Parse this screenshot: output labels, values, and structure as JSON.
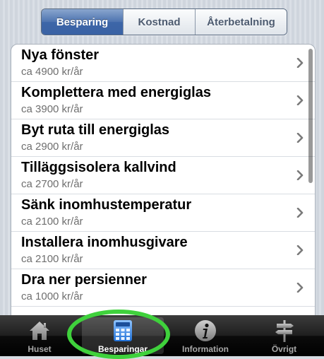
{
  "segments": [
    {
      "label": "Besparing",
      "selected": true
    },
    {
      "label": "Kostnad",
      "selected": false
    },
    {
      "label": "Återbetalning",
      "selected": false
    }
  ],
  "rows": [
    {
      "title": "Nya fönster",
      "subtitle": "ca 4900 kr/år"
    },
    {
      "title": "Komplettera med energiglas",
      "subtitle": "ca 3900 kr/år"
    },
    {
      "title": "Byt ruta till energiglas",
      "subtitle": "ca 2900 kr/år"
    },
    {
      "title": "Tilläggsisolera kallvind",
      "subtitle": "ca 2700 kr/år"
    },
    {
      "title": "Sänk inomhustemperatur",
      "subtitle": "ca 2100 kr/år"
    },
    {
      "title": "Installera inomhusgivare",
      "subtitle": "ca 2100 kr/år"
    },
    {
      "title": "Dra ner persienner",
      "subtitle": "ca 1000 kr/år"
    }
  ],
  "tabs": [
    {
      "label": "Huset",
      "icon": "house-icon",
      "active": false
    },
    {
      "label": "Besparingar",
      "icon": "calculator-icon",
      "active": true
    },
    {
      "label": "Information",
      "icon": "info-icon",
      "active": false
    },
    {
      "label": "Övrigt",
      "icon": "signpost-icon",
      "active": false
    }
  ],
  "colors": {
    "accent": "#3d66a8",
    "highlight_ring": "#3fd13c",
    "subtitle": "#6f6f6f"
  }
}
